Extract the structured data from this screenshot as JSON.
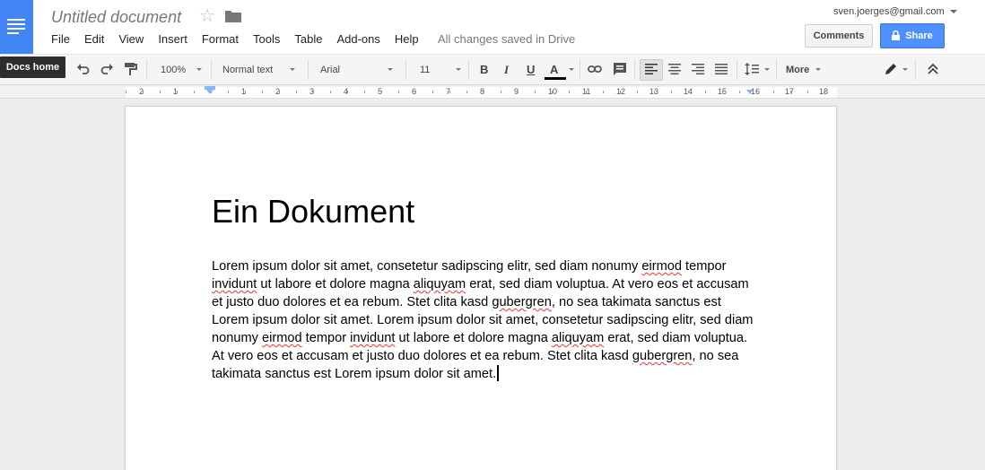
{
  "header": {
    "doc_title": "Untitled document",
    "tooltip": "Docs home",
    "save_status": "All changes saved in Drive",
    "user_email": "sven.joerges@gmail.com",
    "comments_label": "Comments",
    "share_label": "Share",
    "share_color": "#4d90fe",
    "logo_color": "#4285f4",
    "icons": [
      "docs-home-icon",
      "star-icon",
      "folder-icon",
      "lock-icon"
    ]
  },
  "menu": [
    "File",
    "Edit",
    "Insert",
    "Format",
    "Tools",
    "Table",
    "Add-ons",
    "Help"
  ],
  "menu_view": "View",
  "toolbar": {
    "zoom": "100%",
    "style": "Normal text",
    "font": "Arial",
    "size": "11",
    "bold": "B",
    "italic": "I",
    "underline": "U",
    "text_color": "A",
    "more": "More",
    "icons": [
      "undo-icon",
      "redo-icon",
      "paint-format-icon",
      "link-icon",
      "comment-icon",
      "align-left-icon",
      "align-center-icon",
      "align-right-icon",
      "align-justify-icon",
      "line-spacing-icon",
      "pencil-icon",
      "collapse-icon"
    ]
  },
  "ruler": {
    "numbers": [
      "2",
      "1",
      "1",
      "2",
      "3",
      "4",
      "5",
      "6",
      "7",
      "8",
      "9",
      "10",
      "11",
      "12",
      "13",
      "14",
      "15",
      "16",
      "17",
      "18"
    ]
  },
  "document": {
    "heading": "Ein Dokument",
    "body": [
      {
        "t": "Lorem ipsum dolor sit amet, consetetur sadipscing elitr, sed diam nonumy "
      },
      {
        "t": "eirmod",
        "spell": true
      },
      {
        "t": " tempor "
      },
      {
        "t": "invidunt",
        "spell": true
      },
      {
        "t": " ut labore et dolore magna "
      },
      {
        "t": "aliquyam",
        "spell": true
      },
      {
        "t": " erat, sed diam voluptua. At vero eos et accusam et justo duo dolores et ea rebum. Stet clita kasd "
      },
      {
        "t": "gubergren",
        "spell": true
      },
      {
        "t": ", no sea takimata sanctus est Lorem ipsum dolor sit amet. Lorem ipsum dolor sit amet, consetetur sadipscing elitr, sed diam nonumy "
      },
      {
        "t": "eirmod",
        "spell": true
      },
      {
        "t": " tempor "
      },
      {
        "t": "invidunt",
        "spell": true
      },
      {
        "t": " ut labore et dolore magna "
      },
      {
        "t": "aliquyam",
        "spell": true
      },
      {
        "t": " erat, sed diam voluptua. At vero eos et accusam et justo duo dolores et ea rebum. Stet clita kasd "
      },
      {
        "t": "gubergren",
        "spell": true
      },
      {
        "t": ", no sea takimata sanctus est Lorem ipsum dolor sit amet."
      }
    ]
  }
}
